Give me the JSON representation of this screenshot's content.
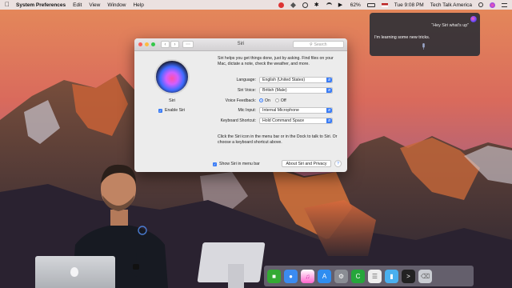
{
  "menubar": {
    "apple": "",
    "app_name": "System Preferences",
    "menus": [
      "Edit",
      "View",
      "Window",
      "Help"
    ],
    "battery": "62%",
    "clock": "Tue 9:08 PM",
    "user": "Tech Talk America"
  },
  "siri_panel": {
    "query": "“Hey Siri what's up”",
    "reply": "I'm learning some new tricks."
  },
  "window": {
    "title": "Siri",
    "search_placeholder": "Search",
    "orb_label": "Siri",
    "enable_label": "Enable Siri",
    "description": "Siri helps you get things done, just by asking. Find files on your Mac, dictate a note, check the weather, and more.",
    "settings": [
      {
        "label": "Language:",
        "value": "English (United States)"
      },
      {
        "label": "Siri Voice:",
        "value": "British (Male)"
      },
      {
        "label": "Voice Feedback:",
        "on": "On",
        "off": "Off"
      },
      {
        "label": "Mic Input:",
        "value": "Internal Microphone"
      },
      {
        "label": "Keyboard Shortcut:",
        "value": "Hold Command Space"
      }
    ],
    "description2": "Click the Siri icon in the menu bar or in the Dock to talk to Siri. Or choose a keyboard shortcut above.",
    "show_in_menubar": "Show Siri in menu bar",
    "about_button": "About Siri and Privacy",
    "help": "?"
  },
  "colors": {
    "accent": "#3a7cf6",
    "close": "#fc605b",
    "minimize": "#fdbc40",
    "zoom": "#34c84a"
  },
  "dock_icons": [
    "facetime-icon",
    "messages-icon",
    "itunes-icon",
    "app-store-icon",
    "system-preferences-icon",
    "camtasia-icon",
    "document-icon",
    "folder-icon",
    "terminal-icon",
    "trash-icon"
  ]
}
